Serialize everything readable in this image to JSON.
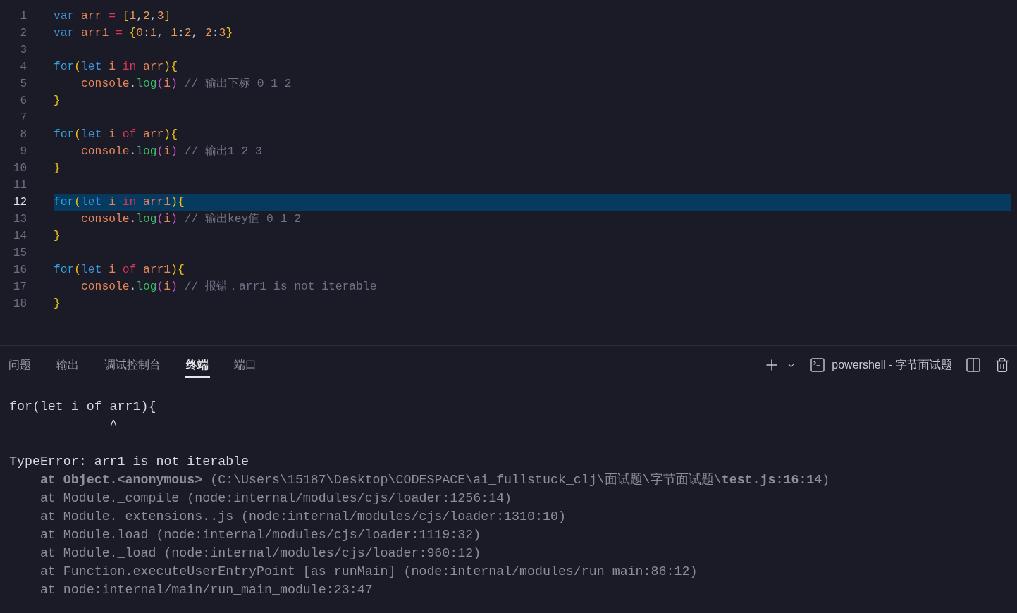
{
  "editor": {
    "lines": [
      {
        "number": "1",
        "current": false,
        "indented": false,
        "tokens": [
          {
            "kind": "keyword",
            "text": "var"
          },
          {
            "kind": "variable",
            "text": " arr"
          },
          {
            "kind": "operator",
            "text": " ="
          },
          {
            "kind": "bracket",
            "text": " ["
          },
          {
            "kind": "number",
            "text": "1"
          },
          {
            "kind": "punct",
            "text": ","
          },
          {
            "kind": "number",
            "text": "2"
          },
          {
            "kind": "punct",
            "text": ","
          },
          {
            "kind": "number",
            "text": "3"
          },
          {
            "kind": "bracket",
            "text": "]"
          }
        ]
      },
      {
        "number": "2",
        "current": false,
        "indented": false,
        "tokens": [
          {
            "kind": "keyword",
            "text": "var"
          },
          {
            "kind": "variable",
            "text": " arr1"
          },
          {
            "kind": "operator",
            "text": " ="
          },
          {
            "kind": "bracket",
            "text": " {"
          },
          {
            "kind": "number",
            "text": "0"
          },
          {
            "kind": "punct",
            "text": ":"
          },
          {
            "kind": "number",
            "text": "1"
          },
          {
            "kind": "punct",
            "text": ", "
          },
          {
            "kind": "number",
            "text": "1"
          },
          {
            "kind": "punct",
            "text": ":"
          },
          {
            "kind": "number",
            "text": "2"
          },
          {
            "kind": "punct",
            "text": ", "
          },
          {
            "kind": "number",
            "text": "2"
          },
          {
            "kind": "punct",
            "text": ":"
          },
          {
            "kind": "number",
            "text": "3"
          },
          {
            "kind": "bracket",
            "text": "}"
          }
        ]
      },
      {
        "number": "3",
        "current": false
      },
      {
        "number": "4",
        "current": false,
        "indented": false,
        "tokens": [
          {
            "kind": "control",
            "text": "for"
          },
          {
            "kind": "bracket",
            "text": "("
          },
          {
            "kind": "keyword",
            "text": "let"
          },
          {
            "kind": "variable",
            "text": " i"
          },
          {
            "kind": "operator",
            "text": " in"
          },
          {
            "kind": "variable",
            "text": " arr"
          },
          {
            "kind": "bracket",
            "text": ")"
          },
          {
            "kind": "bracket",
            "text": "{"
          }
        ]
      },
      {
        "number": "5",
        "current": false,
        "indented": true,
        "tokens": [
          {
            "kind": "variable",
            "text": "console"
          },
          {
            "kind": "punct",
            "text": "."
          },
          {
            "kind": "function",
            "text": "log"
          },
          {
            "kind": "bracket_inner",
            "text": "("
          },
          {
            "kind": "variable",
            "text": "i"
          },
          {
            "kind": "bracket_inner",
            "text": ")"
          },
          {
            "kind": "comment",
            "text": " // 输出下标 0 1 2"
          }
        ]
      },
      {
        "number": "6",
        "current": false,
        "indented": false,
        "tokens": [
          {
            "kind": "bracket",
            "text": "}"
          }
        ]
      },
      {
        "number": "7",
        "current": false
      },
      {
        "number": "8",
        "current": false,
        "indented": false,
        "tokens": [
          {
            "kind": "control",
            "text": "for"
          },
          {
            "kind": "bracket",
            "text": "("
          },
          {
            "kind": "keyword",
            "text": "let"
          },
          {
            "kind": "variable",
            "text": " i"
          },
          {
            "kind": "operator",
            "text": " of"
          },
          {
            "kind": "variable",
            "text": " arr"
          },
          {
            "kind": "bracket",
            "text": ")"
          },
          {
            "kind": "bracket",
            "text": "{"
          }
        ]
      },
      {
        "number": "9",
        "current": false,
        "indented": true,
        "tokens": [
          {
            "kind": "variable",
            "text": "console"
          },
          {
            "kind": "punct",
            "text": "."
          },
          {
            "kind": "function",
            "text": "log"
          },
          {
            "kind": "bracket_inner",
            "text": "("
          },
          {
            "kind": "variable",
            "text": "i"
          },
          {
            "kind": "bracket_inner",
            "text": ")"
          },
          {
            "kind": "comment",
            "text": " // 输出1 2 3"
          }
        ]
      },
      {
        "number": "10",
        "current": false,
        "indented": false,
        "tokens": [
          {
            "kind": "bracket",
            "text": "}"
          }
        ]
      },
      {
        "number": "11",
        "current": false
      },
      {
        "number": "12",
        "current": true,
        "indented": false,
        "tokens": [
          {
            "kind": "control",
            "text": "for"
          },
          {
            "kind": "bracket",
            "text": "("
          },
          {
            "kind": "keyword",
            "text": "let"
          },
          {
            "kind": "variable",
            "text": " i"
          },
          {
            "kind": "operator",
            "text": " in"
          },
          {
            "kind": "variable",
            "text": " arr1"
          },
          {
            "kind": "bracket",
            "text": ")"
          },
          {
            "kind": "bracket",
            "text": "{"
          }
        ]
      },
      {
        "number": "13",
        "current": false,
        "indented": true,
        "tokens": [
          {
            "kind": "variable",
            "text": "console"
          },
          {
            "kind": "punct",
            "text": "."
          },
          {
            "kind": "function",
            "text": "log"
          },
          {
            "kind": "bracket_inner",
            "text": "("
          },
          {
            "kind": "variable",
            "text": "i"
          },
          {
            "kind": "bracket_inner",
            "text": ")"
          },
          {
            "kind": "comment",
            "text": " // 输出key值 0 1 2"
          }
        ]
      },
      {
        "number": "14",
        "current": false,
        "indented": false,
        "tokens": [
          {
            "kind": "bracket",
            "text": "}"
          }
        ]
      },
      {
        "number": "15",
        "current": false
      },
      {
        "number": "16",
        "current": false,
        "indented": false,
        "tokens": [
          {
            "kind": "control",
            "text": "for"
          },
          {
            "kind": "bracket",
            "text": "("
          },
          {
            "kind": "keyword",
            "text": "let"
          },
          {
            "kind": "variable",
            "text": " i"
          },
          {
            "kind": "operator",
            "text": " of"
          },
          {
            "kind": "variable",
            "text": " arr1"
          },
          {
            "kind": "bracket",
            "text": ")"
          },
          {
            "kind": "bracket",
            "text": "{"
          }
        ]
      },
      {
        "number": "17",
        "current": false,
        "indented": true,
        "tokens": [
          {
            "kind": "variable",
            "text": "console"
          },
          {
            "kind": "punct",
            "text": "."
          },
          {
            "kind": "function",
            "text": "log"
          },
          {
            "kind": "bracket_inner",
            "text": "("
          },
          {
            "kind": "variable",
            "text": "i"
          },
          {
            "kind": "bracket_inner",
            "text": ")"
          },
          {
            "kind": "comment",
            "text": " // 报错，arr1 is not iterable"
          }
        ]
      },
      {
        "number": "18",
        "current": false,
        "indented": false,
        "tokens": [
          {
            "kind": "bracket",
            "text": "}"
          }
        ]
      }
    ]
  },
  "panel": {
    "tabs": [
      {
        "label": "问题",
        "selected": false
      },
      {
        "label": "输出",
        "selected": false
      },
      {
        "label": "调试控制台",
        "selected": false
      },
      {
        "label": "终端",
        "selected": true
      },
      {
        "label": "端口",
        "selected": false
      }
    ],
    "terminal_title": "powershell - 字节面试题",
    "lines": [
      {
        "kind": "source",
        "text": "for(let i of arr1){"
      },
      {
        "kind": "caret",
        "text": "             ^"
      },
      {
        "kind": "error",
        "text": "TypeError: arr1 is not iterable"
      },
      {
        "kind": "stack",
        "text": "**at Object.<anonymous>** (C:\\Users\\15187\\Desktop\\CODESPACE\\ai_fullstuck_clj\\面试题\\字节面试题\\**test.js:16:14**)"
      },
      {
        "kind": "stack",
        "text": "at Module._compile (node:internal/modules/cjs/loader:1256:14)"
      },
      {
        "kind": "stack",
        "text": "at Module._extensions..js (node:internal/modules/cjs/loader:1310:10)"
      },
      {
        "kind": "stack",
        "text": "at Module.load (node:internal/modules/cjs/loader:1119:32)"
      },
      {
        "kind": "stack",
        "text": "at Module._load (node:internal/modules/cjs/loader:960:12)"
      },
      {
        "kind": "stack",
        "text": "at Function.executeUserEntryPoint [as runMain] (node:internal/modules/run_main:86:12)"
      },
      {
        "kind": "stack",
        "text": "at node:internal/main/run_main_module:23:47"
      }
    ]
  }
}
